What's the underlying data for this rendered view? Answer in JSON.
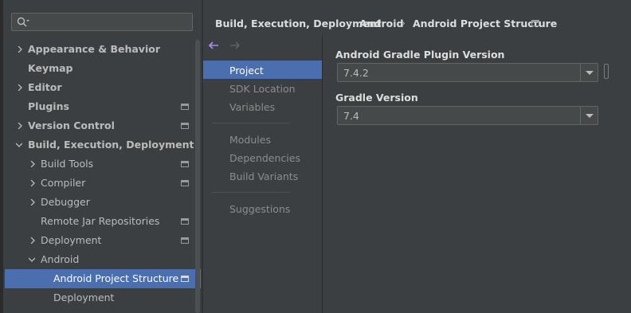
{
  "search": {
    "value": ""
  },
  "tree": [
    {
      "label": "Appearance & Behavior",
      "expanded": false,
      "has_badge": false
    },
    {
      "label": "Keymap",
      "has_badge": false
    },
    {
      "label": "Editor",
      "expanded": false,
      "has_badge": false
    },
    {
      "label": "Plugins",
      "has_badge": true
    },
    {
      "label": "Version Control",
      "expanded": false,
      "has_badge": true
    },
    {
      "label": "Build, Execution, Deployment",
      "expanded": true,
      "has_badge": false
    },
    {
      "label": "Build Tools",
      "expanded": false,
      "has_badge": true
    },
    {
      "label": "Compiler",
      "expanded": false,
      "has_badge": true
    },
    {
      "label": "Debugger",
      "expanded": false,
      "has_badge": false
    },
    {
      "label": "Remote Jar Repositories",
      "has_badge": true
    },
    {
      "label": "Deployment",
      "expanded": false,
      "has_badge": true
    },
    {
      "label": "Android",
      "expanded": true,
      "has_badge": false
    },
    {
      "label": "Android Project Structure",
      "selected": true,
      "has_badge": true
    },
    {
      "label": "Deployment",
      "has_badge": false
    }
  ],
  "breadcrumb": [
    "Build, Execution, Deployment",
    "Android",
    "Android Project Structure"
  ],
  "nav": {
    "items": [
      "Project",
      "SDK Location",
      "Variables",
      "Modules",
      "Dependencies",
      "Build Variants",
      "Suggestions"
    ],
    "selected": "Project"
  },
  "fields": {
    "agp_label": "Android Gradle Plugin Version",
    "agp_value": "7.4.2",
    "gradle_label": "Gradle Version",
    "gradle_value": "7.4"
  },
  "colors": {
    "selection": "#4b6eaf",
    "background": "#3c3f41",
    "back_arrow": "#a88ef0"
  },
  "icons": [
    "search-icon",
    "back-arrow-icon",
    "forward-arrow-icon",
    "project-settings-icon",
    "chevron-right-icon",
    "chevron-down-icon",
    "dropdown-icon"
  ]
}
